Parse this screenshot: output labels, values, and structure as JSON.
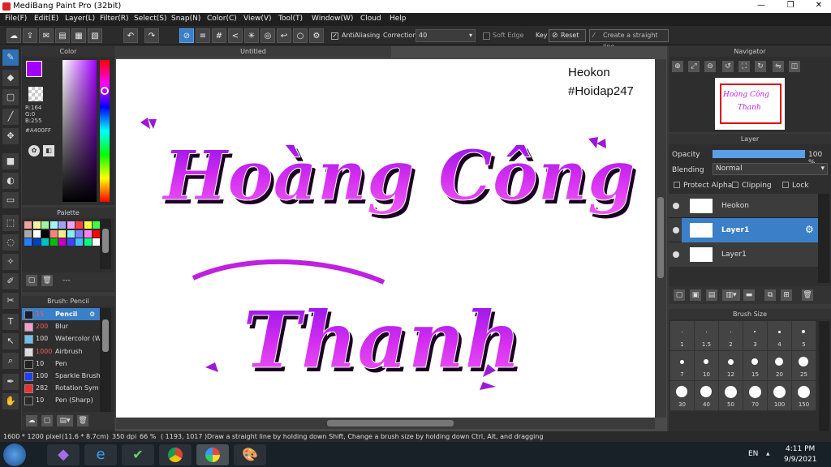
{
  "window": {
    "title": "MediBang Paint Pro (32bit)"
  },
  "menu": [
    "File(F)",
    "Edit(E)",
    "Layer(L)",
    "Filter(R)",
    "Select(S)",
    "Snap(N)",
    "Color(C)",
    "View(V)",
    "Tool(T)",
    "Window(W)",
    "Cloud",
    "Help"
  ],
  "toolbar": {
    "antialiasing": "AntiAliasing",
    "correction_label": "Correction",
    "correction_value": "40",
    "soft_edge": "Soft Edge",
    "key": "Key",
    "reset": "Reset",
    "straight_line": "Create a straight line"
  },
  "color": {
    "title": "Color",
    "r": "R:164",
    "g": "G:0",
    "b": "B:255",
    "hex": "#A400FF",
    "current": "#a400ff"
  },
  "palette": {
    "title": "Palette",
    "more": "---"
  },
  "brush": {
    "title": "Brush: Pencil",
    "items": [
      {
        "size": "15",
        "name": "Pencil"
      },
      {
        "size": "200",
        "name": "Blur"
      },
      {
        "size": "100",
        "name": "Watercolor (W"
      },
      {
        "size": "1000",
        "name": "Airbrush"
      },
      {
        "size": "10",
        "name": "Pen"
      },
      {
        "size": "100",
        "name": "Sparkle Brush"
      },
      {
        "size": "282",
        "name": "Rotation Sym"
      },
      {
        "size": "10",
        "name": "Pen (Sharp)"
      }
    ]
  },
  "document": {
    "tab": "Untitled",
    "watermark_line1": "Heokon",
    "watermark_line2": "#Hoidap247",
    "line1": "Hoàng Công",
    "line2": "Thanh"
  },
  "navigator": {
    "title": "Navigator"
  },
  "layer": {
    "title": "Layer",
    "opacity_label": "Opacity",
    "opacity_value": "100 %",
    "opacity_fraction": 1.0,
    "blending_label": "Blending",
    "blending_value": "Normal",
    "protect_alpha": "Protect Alpha",
    "clipping": "Clipping",
    "lock": "Lock",
    "layers": [
      {
        "name": "Heokon"
      },
      {
        "name": "Layer1"
      },
      {
        "name": "Layer1"
      }
    ]
  },
  "brush_size": {
    "title": "Brush Size",
    "rows": [
      [
        "1",
        "1.5",
        "2",
        "3",
        "4",
        "5"
      ],
      [
        "7",
        "10",
        "12",
        "15",
        "20",
        "25"
      ],
      [
        "30",
        "40",
        "50",
        "70",
        "100",
        "150"
      ]
    ]
  },
  "status": {
    "dims": "1600 * 1200 pixel",
    "cm": "(11.6 * 8.7cm)",
    "dpi": "350 dpi",
    "zoom": "66 %",
    "coords": "( 1193, 1017 )",
    "hint": "Draw a straight line by holding down Shift, Change a brush size by holding down Ctrl, Alt, and dragging"
  },
  "taskbar": {
    "lang": "EN",
    "time": "4:11 PM",
    "date": "9/9/2021"
  },
  "accent": "#3a7fc8",
  "ink": "#c020e0"
}
